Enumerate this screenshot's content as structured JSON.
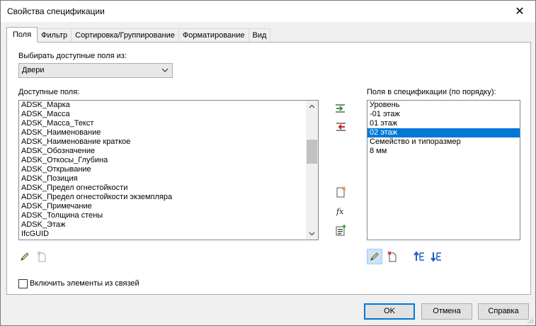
{
  "window": {
    "title": "Свойства спецификации",
    "close_glyph": "✕"
  },
  "tabs": [
    {
      "label": "Поля",
      "active": true
    },
    {
      "label": "Фильтр",
      "active": false
    },
    {
      "label": "Сортировка/Группирование",
      "active": false
    },
    {
      "label": "Форматирование",
      "active": false
    },
    {
      "label": "Вид",
      "active": false
    }
  ],
  "source": {
    "label": "Выбирать доступные поля из:",
    "value": "Двери"
  },
  "available": {
    "label": "Доступные поля:",
    "items": [
      "ADSK_Марка",
      "ADSK_Масса",
      "ADSK_Масса_Текст",
      "ADSK_Наименование",
      "ADSK_Наименование краткое",
      "ADSK_Обозначение",
      "ADSK_Откосы_Глубина",
      "ADSK_Открывание",
      "ADSK_Позиция",
      "ADSK_Предел огнестойкости",
      "ADSK_Предел огнестойкости экземпляра",
      "ADSK_Примечание",
      "ADSK_Толщина стены",
      "ADSK_Этаж",
      "IfcGUID"
    ],
    "scroll_position": 0.3
  },
  "scheduled": {
    "label": "Поля в спецификации (по порядку):",
    "items": [
      {
        "text": "Уровень",
        "selected": false
      },
      {
        "text": "-01 этаж",
        "selected": false
      },
      {
        "text": "01 этаж",
        "selected": false
      },
      {
        "text": "02 этаж",
        "selected": true
      },
      {
        "text": "Семейство и типоразмер",
        "selected": false
      },
      {
        "text": "8 мм",
        "selected": false
      }
    ]
  },
  "include_links": {
    "label": "Включить элементы из связей",
    "checked": false
  },
  "buttons": {
    "ok": "OK",
    "cancel": "Отмена",
    "help": "Справка"
  },
  "colors": {
    "selection": "#0078d7",
    "add_arrow": "#2e9e3a",
    "remove_arrow": "#d11f1f",
    "move_arrow": "#1f5fbf"
  }
}
